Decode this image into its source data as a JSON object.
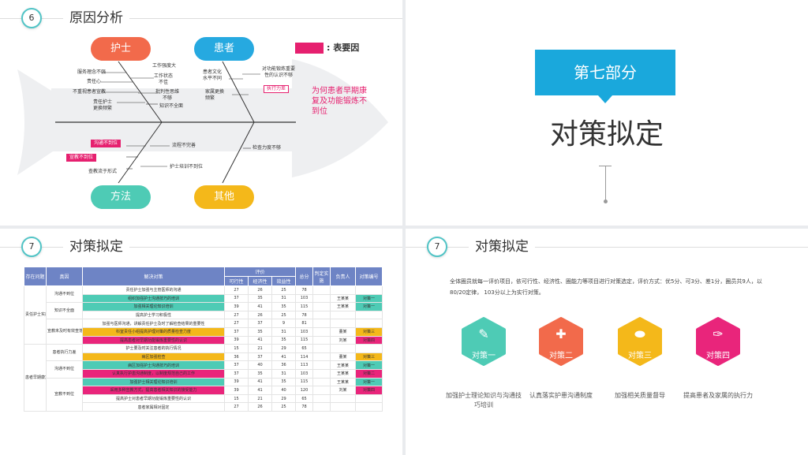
{
  "panel1": {
    "num": "6",
    "title": "原因分析",
    "legend": ": 表要因",
    "categories": {
      "nurse": "护士",
      "patient": "患者",
      "method": "方法",
      "other": "其他"
    },
    "head_text": "为何患者早期康复及功能锻炼不到位",
    "causes": {
      "c1": "服务理念不强",
      "c2": "责任心",
      "c3": "不重视患者宣教",
      "c4": "责任护士\n更换频繁",
      "c5": "工作强度大",
      "c6": "工作状态\n不佳",
      "c7": "批判性思维\n不够",
      "c8": "知识不全面",
      "c9": "患者文化\n水平不同",
      "c10": "家属更换\n频繁",
      "c11": "对功能锻炼重要\n性的认识不够",
      "c12": "执行力差",
      "c13": "沟通不到位",
      "c14": "宣教不到位",
      "c15": "查教流于形式",
      "c16": "流程不完善",
      "c17": "护士培训不到位",
      "c18": "检查力度不够"
    }
  },
  "panel2": {
    "part": "第七部分",
    "title": "对策拟定"
  },
  "panel3": {
    "num": "7",
    "title": "对策拟定",
    "headers": {
      "issue": "存在问题",
      "cause": "真因",
      "measure": "解决对策",
      "eval": "评价",
      "feas": "可行性",
      "econ": "经济性",
      "effect": "效益性",
      "total": "总分",
      "decide": "判定实施",
      "owner": "负责人",
      "no": "对策编号"
    },
    "issue1": "责任护士实施早期康复及功能锻炼意识不全面",
    "issue2": "患者早期康复及功能锻炼不到位",
    "rows": [
      {
        "cause": "沟通不到位",
        "m": "责任护士加强与主管医师的沟通",
        "f": "27",
        "e": "26",
        "x": "25",
        "t": "78",
        "d": "",
        "o": "",
        "n": ""
      },
      {
        "cause": "",
        "m": "组织加强护士沟通技巧的培训",
        "f": "37",
        "e": "35",
        "x": "31",
        "t": "103",
        "d": "",
        "o": "王某某",
        "n": "对策一"
      },
      {
        "cause": "知识不全面",
        "m": "加强相关理论知识培训",
        "f": "39",
        "e": "41",
        "x": "35",
        "t": "115",
        "d": "",
        "o": "王某某",
        "n": "对策一"
      },
      {
        "cause": "",
        "m": "提高护士学习积极性",
        "f": "27",
        "e": "26",
        "x": "25",
        "t": "78",
        "d": "",
        "o": "",
        "n": ""
      },
      {
        "cause": "宣教未及时有效查落实",
        "m": "加强与医师沟通，讲解责任护士及时了解检查结果的重要性",
        "f": "27",
        "e": "37",
        "x": "9",
        "t": "81",
        "d": "",
        "o": "",
        "n": ""
      },
      {
        "cause": "",
        "m": "科室责任小组提高护理对策的质量检查力度",
        "f": "37",
        "e": "35",
        "x": "31",
        "t": "103",
        "d": "",
        "o": "董某",
        "n": "对策三"
      },
      {
        "cause": "",
        "m": "提高患者对早期功能锻炼重要性的认识",
        "f": "39",
        "e": "41",
        "x": "35",
        "t": "115",
        "d": "",
        "o": "刘某",
        "n": "对策四"
      },
      {
        "cause": "患者执行力差",
        "m": "护士要及时关注患者的执行情况",
        "f": "15",
        "e": "21",
        "x": "29",
        "t": "65",
        "d": "",
        "o": "",
        "n": ""
      },
      {
        "cause": "",
        "m": "病区加强检查",
        "f": "36",
        "e": "37",
        "x": "41",
        "t": "114",
        "d": "",
        "o": "董某",
        "n": "对策三"
      },
      {
        "cause": "沟通不到位",
        "m": "病区加强护士沟通技巧的培训",
        "f": "37",
        "e": "40",
        "x": "36",
        "t": "113",
        "d": "",
        "o": "王某某",
        "n": "对策一"
      },
      {
        "cause": "",
        "m": "认真执行护患沟通制度，以制度规范自己的工作",
        "f": "37",
        "e": "35",
        "x": "31",
        "t": "103",
        "d": "",
        "o": "王某某",
        "n": "对策二"
      },
      {
        "cause": "宣教不到位",
        "m": "加强护士相关理论知识培训",
        "f": "39",
        "e": "41",
        "x": "35",
        "t": "115",
        "d": "",
        "o": "王某某",
        "n": "对策一"
      },
      {
        "cause": "",
        "m": "采用多种宣教方式，提高患者相关知识的接受能力",
        "f": "39",
        "e": "41",
        "x": "40",
        "t": "120",
        "d": "",
        "o": "刘某",
        "n": "对策四"
      },
      {
        "cause": "",
        "m": "提高护士对患者早期功能锻炼重要性的认识",
        "f": "15",
        "e": "21",
        "x": "29",
        "t": "65",
        "d": "",
        "o": "",
        "n": ""
      },
      {
        "cause": "",
        "m": "患者家属相对固定",
        "f": "27",
        "e": "26",
        "x": "25",
        "t": "78",
        "d": "",
        "o": "",
        "n": ""
      }
    ]
  },
  "panel4": {
    "num": "7",
    "title": "对策拟定",
    "intro": "全体圈员就每一评价项目，依可行性、经济性、圈能力等项目进行对策选定，评价方式：优5分、可3分、差1分，圈员共9人，以80/20定律， 103分以上为实行对策。",
    "items": [
      {
        "label": "对策一",
        "color": "#4ecbb5",
        "icon": "pen-icon",
        "desc": "加强护士理论知识与沟通技巧培训"
      },
      {
        "label": "对策二",
        "color": "#f26a4b",
        "icon": "bandage-icon",
        "desc": "认真落实护患沟通制度"
      },
      {
        "label": "对策三",
        "color": "#f4b81a",
        "icon": "pills-icon",
        "desc": "加强相关质量督导"
      },
      {
        "label": "对策四",
        "color": "#e9257b",
        "icon": "syringe-icon",
        "desc": "提高患者及家属的执行力"
      }
    ]
  }
}
